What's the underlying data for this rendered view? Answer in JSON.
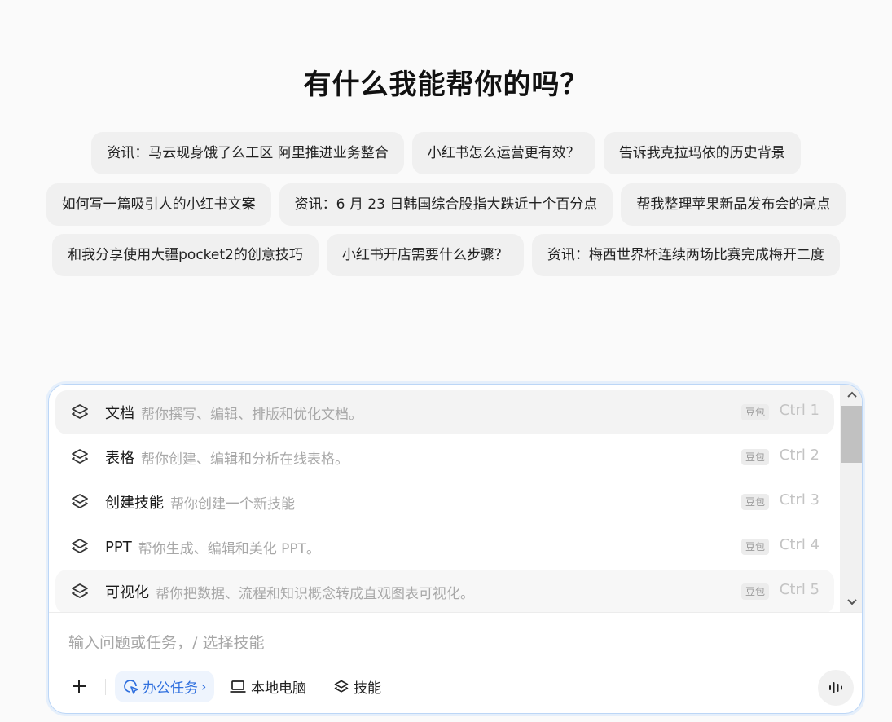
{
  "heading": "有什么我能帮你的吗？",
  "suggestions": [
    [
      "资讯：马云现身饿了么工区 阿里推进业务整合",
      "小红书怎么运营更有效？",
      "告诉我克拉玛依的历史背景"
    ],
    [
      "如何写一篇吸引人的小红书文案",
      "资讯：6 月 23 日韩国综合股指大跌近十个百分点",
      "帮我整理苹果新品发布会的亮点"
    ],
    [
      "和我分享使用大疆pocket2的创意技巧",
      "小红书开店需要什么步骤？",
      "资讯：梅西世界杯连续两场比赛完成梅开二度"
    ]
  ],
  "skills": [
    {
      "name": "文档",
      "desc": "帮你撰写、编辑、排版和优化文档。",
      "badge": "豆包",
      "shortcut": "Ctrl 1"
    },
    {
      "name": "表格",
      "desc": "帮你创建、编辑和分析在线表格。",
      "badge": "豆包",
      "shortcut": "Ctrl 2"
    },
    {
      "name": "创建技能",
      "desc": "帮你创建一个新技能",
      "badge": "豆包",
      "shortcut": "Ctrl 3"
    },
    {
      "name": "PPT",
      "desc": "帮你生成、编辑和美化 PPT。",
      "badge": "豆包",
      "shortcut": "Ctrl 4"
    },
    {
      "name": "可视化",
      "desc": "帮你把数据、流程和知识概念转成直观图表可视化。",
      "badge": "豆包",
      "shortcut": "Ctrl 5"
    }
  ],
  "input": {
    "placeholder": "输入问题或任务，/ 选择技能",
    "value": ""
  },
  "toolbar": {
    "office_label": "办公任务",
    "office_chevron": "›",
    "local_label": "本地电脑",
    "skill_label": "技能"
  },
  "icons": {
    "skill": "layers-icon",
    "plus": "plus-icon",
    "office": "cursor-click-icon",
    "local": "laptop-icon",
    "voice": "voice-wave-icon",
    "scroll_up": "chevron-up-icon",
    "scroll_down": "chevron-down-icon"
  },
  "colors": {
    "accent": "#2f6fde",
    "composer_border": "#bcd6f6",
    "chip_bg": "#f0f0f0"
  }
}
